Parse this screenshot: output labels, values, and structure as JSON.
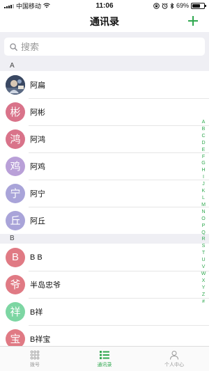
{
  "status_bar": {
    "carrier": "中国移动",
    "time": "11:06",
    "battery": "69%",
    "battery_level": 0.69
  },
  "header": {
    "title": "通讯录",
    "add_icon": "plus-icon"
  },
  "search": {
    "placeholder": "搜索",
    "value": ""
  },
  "sections": [
    {
      "letter": "A",
      "contacts": [
        {
          "name": "阿扁",
          "avatar_char": "",
          "color": "",
          "photo": true
        },
        {
          "name": "阿彬",
          "avatar_char": "彬",
          "color": "#d9738a"
        },
        {
          "name": "阿鸿",
          "avatar_char": "鸿",
          "color": "#d9738a"
        },
        {
          "name": "阿鸡",
          "avatar_char": "鸡",
          "color": "#b9a0d8"
        },
        {
          "name": "阿宁",
          "avatar_char": "宁",
          "color": "#a9a4d9"
        },
        {
          "name": "阿丘",
          "avatar_char": "丘",
          "color": "#a9a4d9"
        }
      ]
    },
    {
      "letter": "B",
      "contacts": [
        {
          "name": "B B",
          "avatar_char": "B",
          "color": "#e07a84"
        },
        {
          "name": "半岛忠爷",
          "avatar_char": "爷",
          "color": "#e07a84"
        },
        {
          "name": "B祥",
          "avatar_char": "祥",
          "color": "#7dd6a3"
        },
        {
          "name": "B祥宝",
          "avatar_char": "宝",
          "color": "#e07a84"
        }
      ]
    }
  ],
  "index_letters": [
    "A",
    "B",
    "C",
    "D",
    "E",
    "F",
    "G",
    "H",
    "I",
    "J",
    "K",
    "L",
    "M",
    "N",
    "O",
    "P",
    "Q",
    "R",
    "S",
    "T",
    "U",
    "V",
    "W",
    "X",
    "Y",
    "Z",
    "#"
  ],
  "tabs": [
    {
      "label": "拨号",
      "icon": "dialpad-icon",
      "active": false
    },
    {
      "label": "通讯录",
      "icon": "contacts-list-icon",
      "active": true
    },
    {
      "label": "个人中心",
      "icon": "person-icon",
      "active": false
    }
  ],
  "colors": {
    "accent": "#2fa84f",
    "section_bg": "#efeff4"
  }
}
